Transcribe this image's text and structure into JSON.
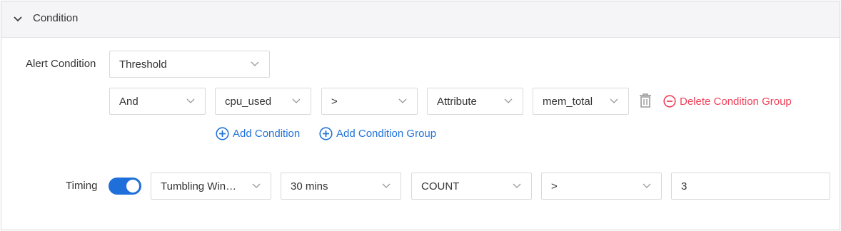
{
  "header": {
    "title": "Condition",
    "icon": "chevron-down-icon"
  },
  "alert_condition": {
    "label": "Alert Condition",
    "type_value": "Threshold"
  },
  "condition_group": {
    "logic": "And",
    "metric": "cpu_used",
    "operator": ">",
    "compare_type": "Attribute",
    "compare_value": "mem_total",
    "delete_label": "Delete Condition Group"
  },
  "actions": {
    "add_condition": "Add Condition",
    "add_condition_group": "Add Condition Group"
  },
  "timing": {
    "label": "Timing",
    "enabled": true,
    "window_type": "Tumbling Win…",
    "window_size": "30 mins",
    "aggregation": "COUNT",
    "operator": ">",
    "threshold": "3"
  },
  "colors": {
    "accent": "#1e6fd9",
    "link": "#2273d9",
    "danger": "#f0415a",
    "header_bg": "#f5f5f7",
    "border": "#d9d9d9"
  }
}
